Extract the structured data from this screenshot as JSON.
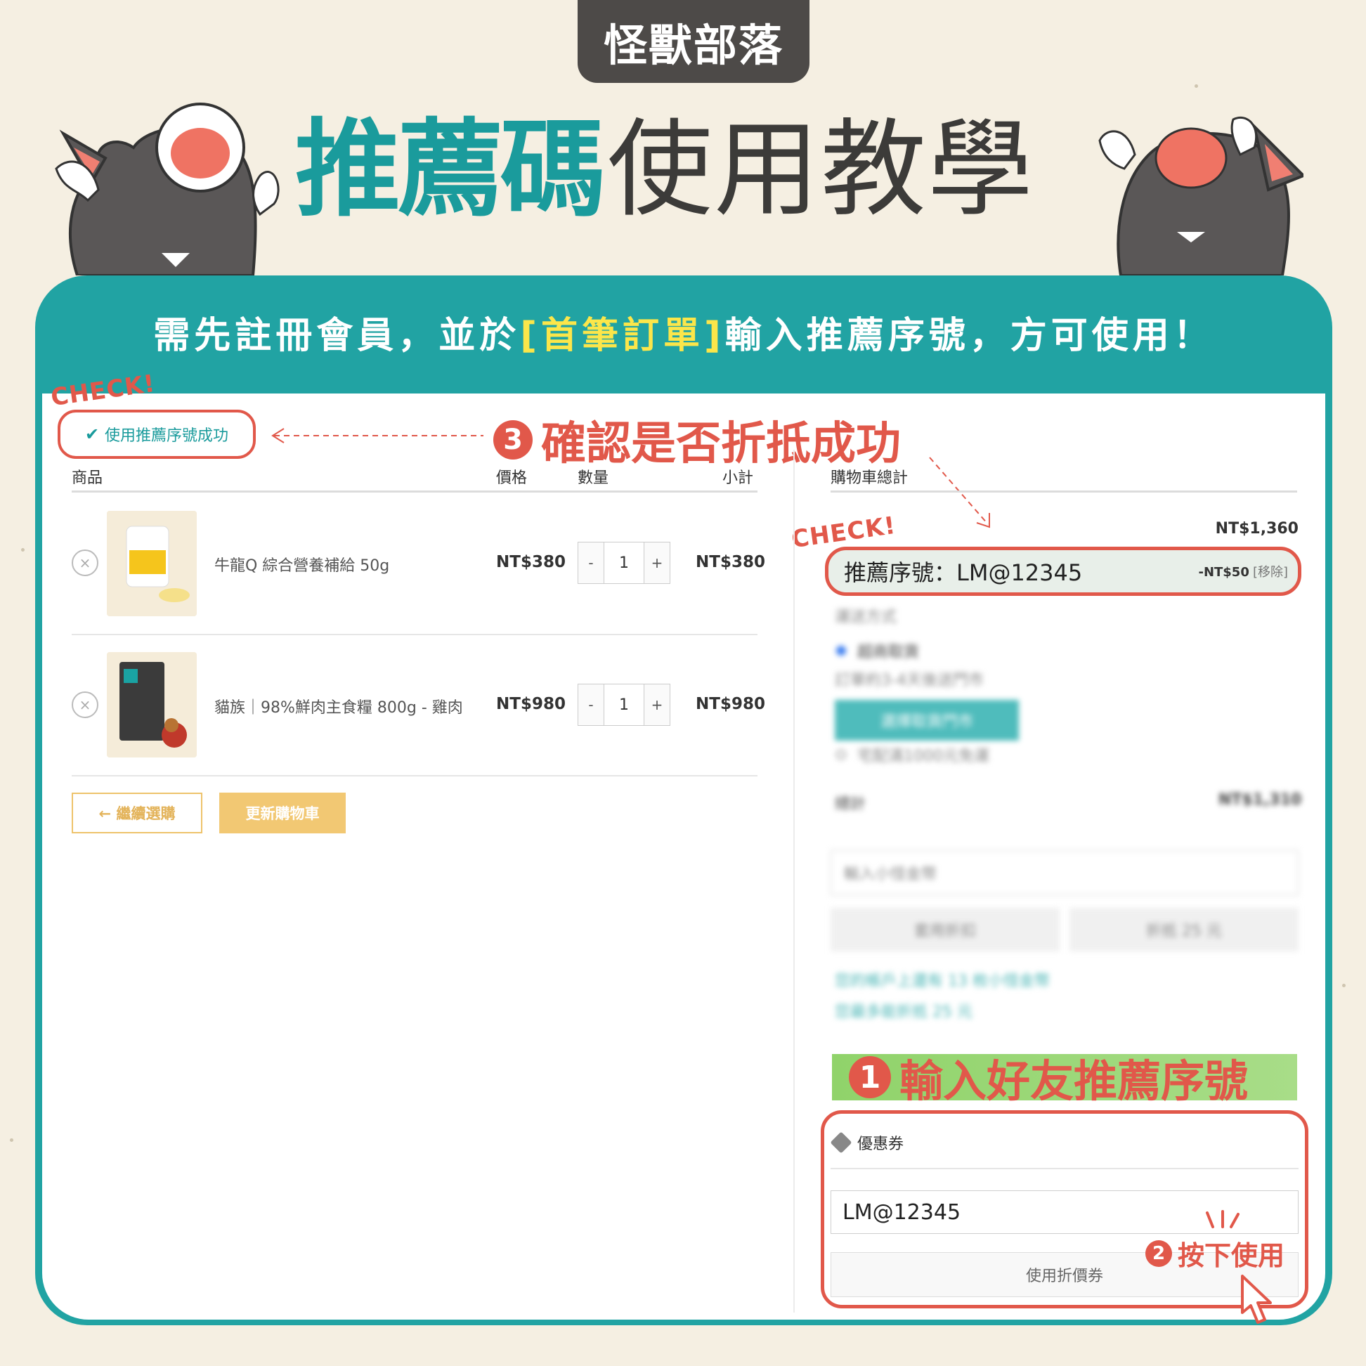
{
  "brand": "怪獸部落",
  "title": {
    "accent": "推薦碼",
    "rest": "使用教學"
  },
  "banner": {
    "part1": "需先註冊會員，並於",
    "highlight": "[首筆訂單]",
    "part2": "輸入推薦序號，方可使用！"
  },
  "check_tag": "CHECK!",
  "success_label": "使用推薦序號成功",
  "step3": {
    "num": "3",
    "text": "確認是否折抵成功"
  },
  "table": {
    "headers": {
      "product": "商品",
      "price": "價格",
      "qty": "數量",
      "subtotal": "小計"
    },
    "rows": [
      {
        "remove": "×",
        "name": "牛龍Q 綜合營養補給 50g",
        "price": "NT$380",
        "minus": "-",
        "qty": "1",
        "plus": "+",
        "subtotal": "NT$380"
      },
      {
        "remove": "×",
        "name": "貓族｜98%鮮肉主食糧 800g - 雞肉",
        "price": "NT$980",
        "minus": "-",
        "qty": "1",
        "plus": "+",
        "subtotal": "NT$980"
      }
    ]
  },
  "buttons": {
    "continue": "← 繼續選購",
    "update": "更新購物車",
    "apply_coupon": "使用折價券"
  },
  "cart_total": {
    "title": "購物車總計",
    "subtotal": "NT$1,360",
    "referral_code": "推薦序號：LM@12345",
    "discount": "-NT$50",
    "remove": "[移除]",
    "blurred_lines": [
      "運送方式",
      "超商取貨",
      "訂單約3-4天後送門市",
      "選擇取貨門市",
      "宅配滿1000元免運",
      "總計",
      "NT$1,310",
      "輸入小怪金幣",
      "套用折扣",
      "折抵 25 元",
      "您的帳戶上還有 13 枚小怪金幣",
      "您最多能折抵 25 元"
    ]
  },
  "step1": {
    "num": "1",
    "text": "輸入好友推薦序號"
  },
  "coupon": {
    "label": "優惠券",
    "value": "LM@12345"
  },
  "step2": {
    "num": "2",
    "text": "按下使用"
  },
  "colors": {
    "teal": "#21a3a3",
    "accent_red": "#e1584a",
    "yellow": "#fbe64a",
    "green_highlight": "#90d36a"
  }
}
